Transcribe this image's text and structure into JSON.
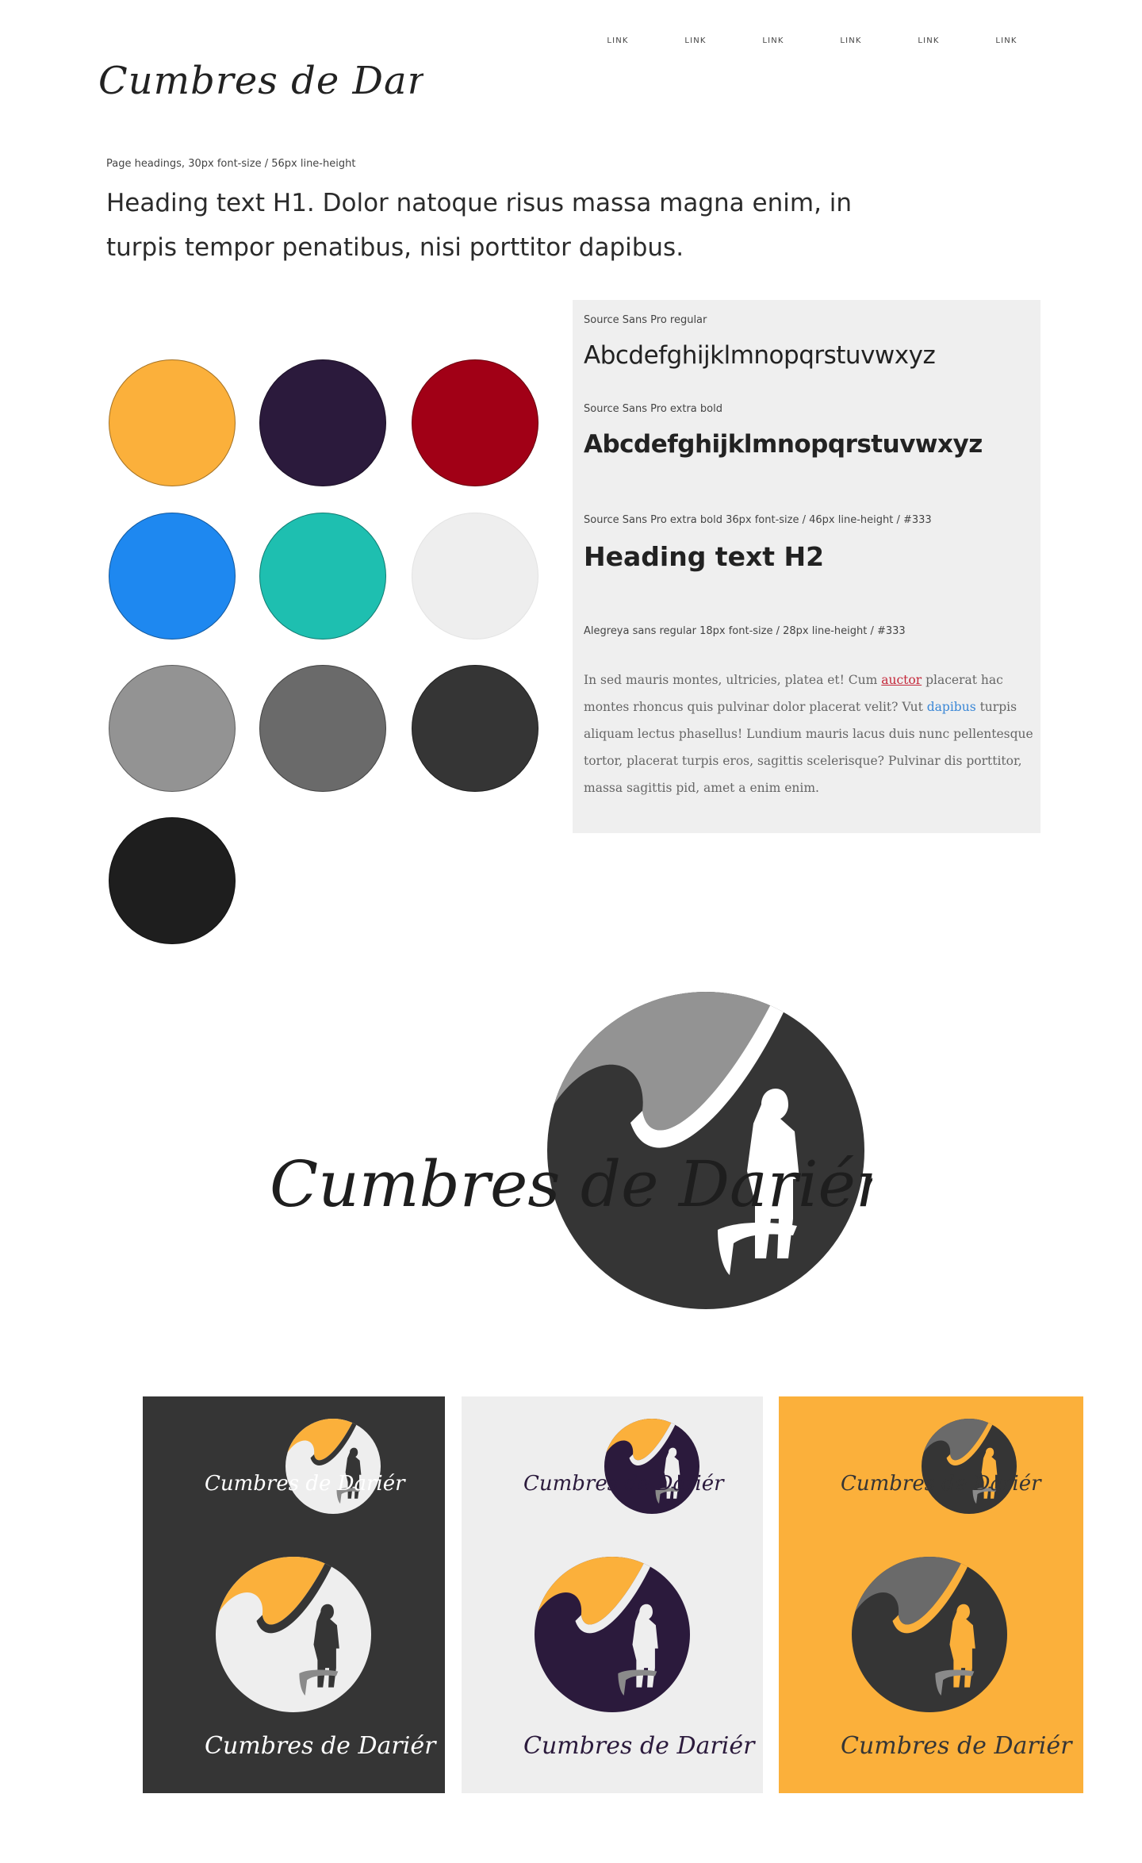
{
  "brand": {
    "name": "Cumbres de Dariér"
  },
  "nav": {
    "links": [
      "LINK",
      "LINK",
      "LINK",
      "LINK",
      "LINK",
      "LINK"
    ]
  },
  "typography": {
    "h1_caption": "Page headings, 30px font-size / 56px line-height",
    "h1_text": "Heading text H1. Dolor natoque risus massa magna enim, in turpis tempor penatibus, nisi porttitor dapibus.",
    "regular_caption": "Source Sans Pro  regular",
    "regular_sample": "Abcdefghijklmnopqrstuvwxyz",
    "bold_caption": "Source Sans Pro  extra bold",
    "bold_sample": "Abcdefghijklmnopqrstuvwxyz",
    "h2_caption": "Source Sans Pro  extra bold 36px font-size / 46px line-height / #333",
    "h2_text": "Heading text H2",
    "body_caption": "Alegreya sans regular 18px font-size / 28px line-height / #333",
    "body_part1": "In sed mauris montes, ultricies, platea et! Cum ",
    "body_link1": "auctor",
    "body_part2": " placerat hac montes rhoncus quis pulvinar dolor placerat velit? Vut ",
    "body_link2": "dapibus",
    "body_part3": " turpis aliquam lectus phasellus! Lundium mauris lacus duis nunc pellentesque tortor, placerat turpis eros, sagittis scelerisque? Pulvinar dis porttitor, massa sagittis pid, amet a enim enim."
  },
  "palette": [
    "#FBB03B",
    "#2B1A3C",
    "#A10016",
    "#1E88F0",
    "#1EBFB0",
    "#EEEEEE",
    "#939393",
    "#6A6A6A",
    "#353535",
    "#1E1E1E"
  ],
  "variants": [
    {
      "background": "#353535",
      "accent": "#FBB03B",
      "circle": "#EEEEEE",
      "figure": "#353535",
      "script": "#FFFFFF"
    },
    {
      "background": "#EEEEEE",
      "accent": "#FBB03B",
      "circle": "#2B1A3C",
      "figure": "#EEEEEE",
      "script": "#2B1A3C"
    },
    {
      "background": "#FBB03B",
      "accent": "#6A6A6A",
      "circle": "#353535",
      "figure": "#FBB03B",
      "script": "#353535"
    }
  ]
}
